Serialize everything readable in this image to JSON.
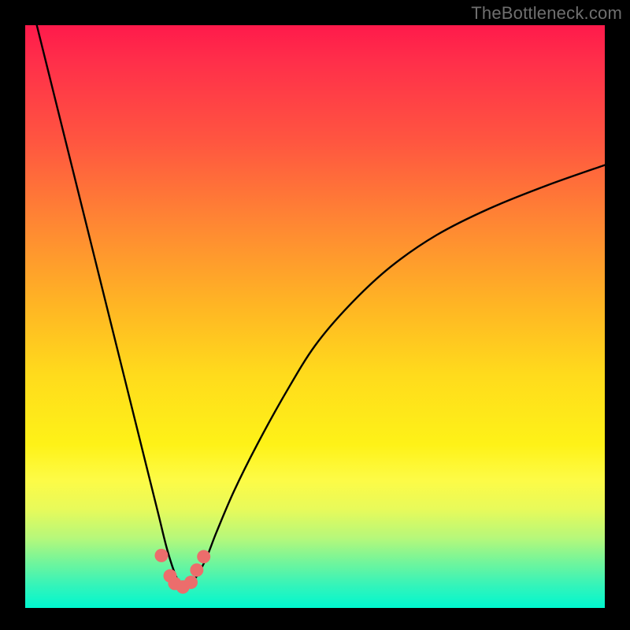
{
  "attribution": "TheBottleneck.com",
  "colors": {
    "page_bg": "#000000",
    "attribution_text": "#6f6f6f",
    "curve_stroke": "#000000",
    "marker_fill": "#ec6d6c",
    "marker_stroke": "#a33c3c"
  },
  "chart_data": {
    "type": "line",
    "title": "",
    "xlabel": "",
    "ylabel": "",
    "xlim": [
      0,
      100
    ],
    "ylim": [
      0,
      100
    ],
    "grid": false,
    "legend": false,
    "series": [
      {
        "name": "bottleneck-curve",
        "x": [
          0,
          3,
          6,
          9,
          12,
          15,
          17,
          19,
          21,
          23,
          24.5,
          26,
          27.3,
          28.7,
          31,
          33,
          36,
          40,
          45,
          50,
          56,
          63,
          71,
          80,
          90,
          100
        ],
        "y": [
          108,
          96,
          84,
          72,
          60,
          48,
          40,
          32,
          24,
          16,
          10,
          5.5,
          3.5,
          4.2,
          8,
          13,
          20,
          28,
          37,
          45,
          52,
          58.5,
          64,
          68.5,
          72.5,
          76
        ]
      }
    ],
    "markers": [
      {
        "x": 23.5,
        "y": 9.0
      },
      {
        "x": 25.0,
        "y": 5.5
      },
      {
        "x": 25.8,
        "y": 4.2
      },
      {
        "x": 27.2,
        "y": 3.6
      },
      {
        "x": 28.6,
        "y": 4.4
      },
      {
        "x": 29.6,
        "y": 6.5
      },
      {
        "x": 30.8,
        "y": 8.8
      }
    ],
    "background_gradient": {
      "direction": "top-to-bottom",
      "stops": [
        {
          "pos": 0.0,
          "color": "#ff1a4b"
        },
        {
          "pos": 0.2,
          "color": "#ff5640"
        },
        {
          "pos": 0.48,
          "color": "#ffb524"
        },
        {
          "pos": 0.72,
          "color": "#fef218"
        },
        {
          "pos": 0.88,
          "color": "#b6f87a"
        },
        {
          "pos": 1.0,
          "color": "#00f7cf"
        }
      ]
    }
  }
}
